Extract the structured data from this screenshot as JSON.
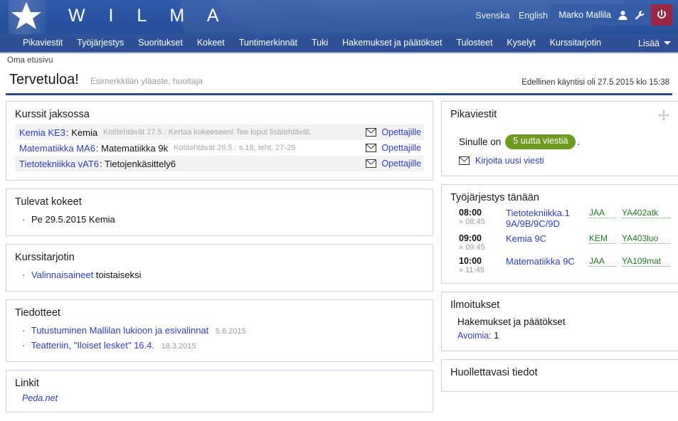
{
  "header": {
    "brand": "W I L M A",
    "logo_icon": "star-icon",
    "languages": [
      {
        "label": "Svenska"
      },
      {
        "label": "English"
      }
    ],
    "user_name": "Marko Mallila",
    "user_icon": "user-icon",
    "settings_icon": "wrench-icon",
    "logout_icon": "power-icon",
    "accent_blue": "#2a54a0",
    "logout_red": "#9c2742"
  },
  "nav": {
    "items": [
      {
        "label": "Pikaviestit"
      },
      {
        "label": "Työjärjestys"
      },
      {
        "label": "Suoritukset"
      },
      {
        "label": "Kokeet"
      },
      {
        "label": "Tuntimerkinnät"
      },
      {
        "label": "Tuki"
      },
      {
        "label": "Hakemukset ja päätökset"
      },
      {
        "label": "Tulosteet"
      },
      {
        "label": "Kyselyt"
      },
      {
        "label": "Kurssitarjotin"
      }
    ],
    "more_label": "Lisää",
    "more_icon": "chevron-down-icon"
  },
  "breadcrumb": "Oma etusivu",
  "title": {
    "heading": "Tervetuloa!",
    "subtitle": "Esimerkkilän yläaste, huoltaja",
    "last_visit": "Edellinen käyntisi oli 27.5.2015 klo 15:38"
  },
  "courses_panel": {
    "title": "Kurssit jaksossa",
    "teacher_link_label": "Opettajille",
    "mail_icon": "envelope-icon",
    "rows": [
      {
        "code": "Kemia KE3",
        "name": ": Kemia",
        "homework": "Kotitehtävät 27.5.: Kertaa kokeeseen! Tee loput lisätehtävät.",
        "teacher_label": "Opettajille"
      },
      {
        "code": "Matematiikka MA6",
        "name": ": Matematiikka 9k",
        "homework": "Kotitehtävät 26.5.: s.18, teht. 27-29",
        "teacher_label": "Opettajille"
      },
      {
        "code": "Tietotekniikka vAT6",
        "name": ": Tietojenkäsittely6",
        "homework": "",
        "teacher_label": "Opettajille"
      }
    ]
  },
  "exams_panel": {
    "title": "Tulevat kokeet",
    "items": [
      {
        "text": "Pe 29.5.2015 Kemia"
      }
    ]
  },
  "offering_panel": {
    "title": "Kurssitarjotin",
    "link_label": "Valinnaisaineet",
    "link_suffix": " toistaiseksi"
  },
  "bulletins_panel": {
    "title": "Tiedotteet",
    "items": [
      {
        "title": "Tutustuminen Mallilan lukioon ja esivalinnat",
        "date": "5.6.2015"
      },
      {
        "title": "Teatteriin, \"Iloiset lesket\" 16.4.",
        "date": "18.3.2015"
      }
    ]
  },
  "links_panel": {
    "title": "Linkit",
    "items": [
      {
        "label": "Peda.net"
      }
    ]
  },
  "messages_panel": {
    "title": "Pikaviestit",
    "drag_icon": "move-icon",
    "prefix": "Sinulle on",
    "badge": "5 uutta viestiä",
    "suffix": ".",
    "badge_color": "#6d9b1f",
    "compose_label": "Kirjoita uusi viesti",
    "compose_icon": "envelope-icon"
  },
  "schedule_panel": {
    "title": "Työjärjestys tänään",
    "rows": [
      {
        "start": "08:00",
        "end": "» 08:45",
        "subject": "Tietotekniikka.1 9A/9B/9C/9D",
        "teacher": "JAA",
        "room": "YA402atk"
      },
      {
        "start": "09:00",
        "end": "» 09:45",
        "subject": "Kemia 9C",
        "teacher": "KEM",
        "room": "YA403luo"
      },
      {
        "start": "10:00",
        "end": "» 11:45",
        "subject": "Matematiikka 9C",
        "teacher": "JAA",
        "room": "YA109mat"
      }
    ]
  },
  "notifications_panel": {
    "title": "Ilmoitukset",
    "subtitle": "Hakemukset ja päätökset",
    "open_label": "Avoimia:",
    "open_count": "1"
  },
  "guardian_panel": {
    "title": "Huollettavasi tiedot"
  }
}
